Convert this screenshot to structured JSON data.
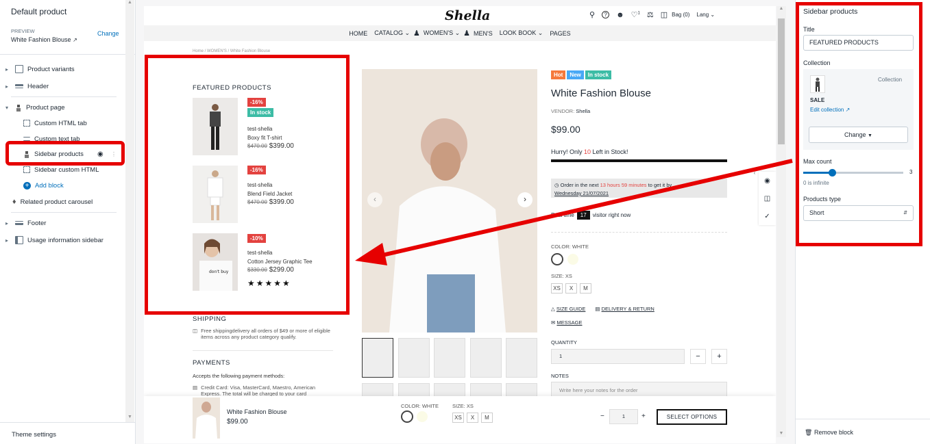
{
  "left_sidebar": {
    "title": "Default product",
    "preview_label": "PREVIEW",
    "change_link": "Change",
    "preview_value": "White Fashion Blouse",
    "items": [
      {
        "label": "Product variants"
      },
      {
        "label": "Header"
      },
      {
        "label": "Product page"
      },
      {
        "label": "Custom HTML tab"
      },
      {
        "label": "Custom text tab"
      },
      {
        "label": "Sidebar products"
      },
      {
        "label": "Sidebar custom HTML"
      },
      {
        "label": "Add block"
      },
      {
        "label": "Related product carousel"
      },
      {
        "label": "Footer"
      },
      {
        "label": "Usage information sidebar"
      }
    ],
    "theme_settings": "Theme settings"
  },
  "store": {
    "logo": "Shella",
    "wishlist_count": "1",
    "bag": "Bag (0)",
    "lang": "Lang",
    "nav": [
      "HOME",
      "CATALOG",
      "WOMEN'S",
      "MEN'S",
      "LOOK BOOK",
      "PAGES"
    ],
    "breadcrumb": "Home  /  WOMEN'S  /  White Fashion Blouse",
    "featured": {
      "title": "FEATURED PRODUCTS",
      "products": [
        {
          "discount": "-16%",
          "stock": "In stock",
          "vendor": "test-shella",
          "name": "Boxy fit T-shirt",
          "old": "$470.00",
          "price": "$399.00"
        },
        {
          "discount": "-16%",
          "vendor": "test-shella",
          "name": "Blend Field Jacket",
          "old": "$470.00",
          "price": "$399.00"
        },
        {
          "discount": "-10%",
          "vendor": "test-shella",
          "name": "Cotton Jersey Graphic Tee",
          "old": "$330.00",
          "price": "$299.00",
          "rating": 5
        }
      ]
    },
    "shipping": {
      "title": "SHIPPING",
      "text": "Free shippingdelivery all orders of $49 or more of eligible items across any product category qualify."
    },
    "payments": {
      "title": "PAYMENTS",
      "lead": "Accepts the following payment methods:",
      "text": "Credit Card: Visa, MasterCard, Maestro, American Express. The total will be charged to your card"
    },
    "product": {
      "badges": [
        {
          "text": "Hot",
          "color": "#f5793b"
        },
        {
          "text": "New",
          "color": "#48a8f5"
        },
        {
          "text": "In stock",
          "color": "#3cbca5"
        }
      ],
      "title": "White Fashion Blouse",
      "vendor_label": "VENDOR:",
      "vendor": "Shella",
      "price": "$99.00",
      "hurry_a": "Hurry! Only ",
      "hurry_n": "10",
      "hurry_b": " Left in Stock!",
      "order_a": "Order in the next ",
      "order_time": "13 hours 59 minutes",
      "order_b": " to get it by",
      "order_date": "Wednesday 21/07/2021",
      "realtime_a": "Real time",
      "realtime_n": "17",
      "realtime_b": "visitor right now",
      "color_label": "COLOR: WHITE",
      "size_label": "SIZE: XS",
      "sizes": [
        "XS",
        "X",
        "M"
      ],
      "size_guide": "SIZE GUIDE",
      "delivery": "DELIVERY & RETURN",
      "message": "MESSAGE",
      "qty_label": "QUANTITY",
      "qty": "1",
      "notes_label": "NOTES",
      "notes_placeholder": "Write here your notes for the order"
    },
    "sticky": {
      "name": "White Fashion Blouse",
      "price": "$99.00",
      "color": "COLOR: WHITE",
      "size": "SIZE: XS",
      "sizes": [
        "XS",
        "X",
        "M"
      ],
      "qty": "1",
      "button": "SELECT OPTIONS"
    }
  },
  "right_sidebar": {
    "title": "Sidebar products",
    "title_label": "Title",
    "title_value": "FEATURED PRODUCTS",
    "collection_label": "Collection",
    "collection_tag": "Collection",
    "collection_name": "SALE",
    "edit_collection": "Edit collection",
    "change": "Change",
    "max_label": "Max count",
    "max_value": "3",
    "max_hint": "0 is infinite",
    "type_label": "Products type",
    "type_value": "Short",
    "remove": "Remove block"
  }
}
